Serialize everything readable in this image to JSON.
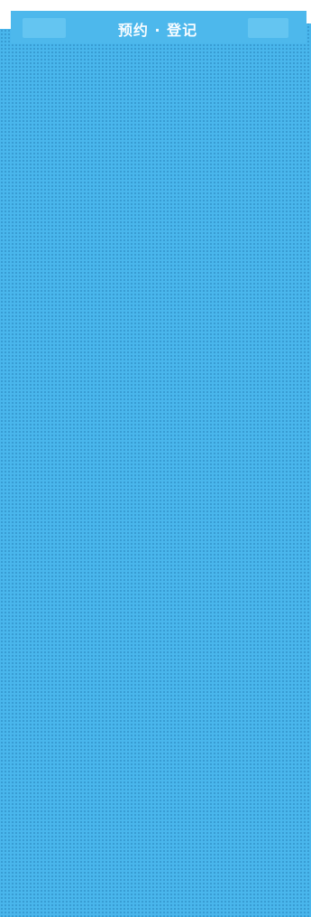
{
  "header": {
    "title": "预约 · 登记",
    "left_button": "",
    "right_button": ""
  },
  "colors": {
    "background": "#49b6ec",
    "header": "#4db8ec",
    "button": "#64c5f1",
    "frame": "#ffffff"
  }
}
